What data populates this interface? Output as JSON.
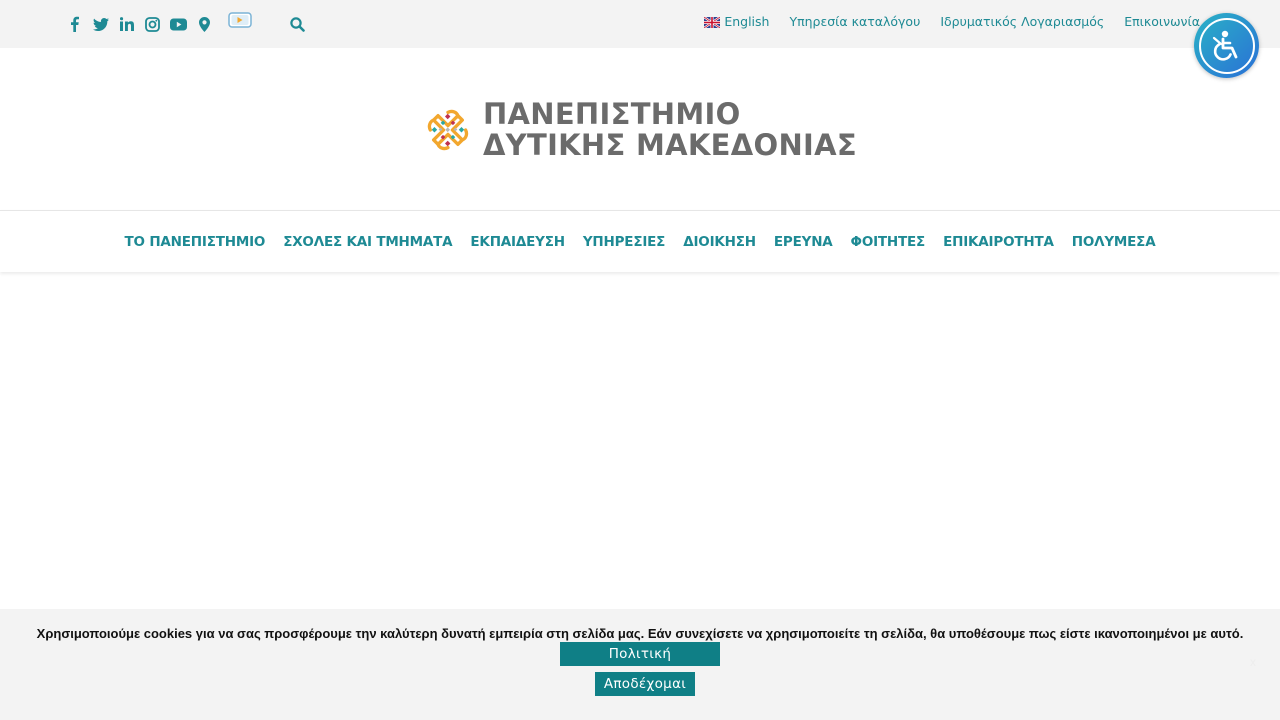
{
  "topbar": {
    "social_icons": [
      "facebook-icon",
      "twitter-icon",
      "linkedin-icon",
      "instagram-icon",
      "youtube-icon",
      "map-marker-icon",
      "video-tv-icon"
    ],
    "search_icon": "search-icon",
    "links": {
      "english": "English",
      "catalog": "Υπηρεσία καταλόγου",
      "account": "Ιδρυματικός Λογαριασμός",
      "contact": "Επικοινωνία"
    }
  },
  "logo": {
    "line1": "ΠΑΝΕΠΙΣΤΗΜΙΟ",
    "line2": "ΔΥΤΙΚΗΣ ΜΑΚΕΔΟΝΙΑΣ"
  },
  "nav": {
    "items": [
      "ΤΟ ΠΑΝΕΠΙΣΤΗΜΙΟ",
      "ΣΧΟΛΕΣ ΚΑΙ ΤΜΗΜΑΤΑ",
      "ΕΚΠΑΙΔΕΥΣΗ",
      "ΥΠΗΡΕΣΙΕΣ",
      "ΔΙΟΙΚΗΣΗ",
      "ΕΡΕΥΝΑ",
      "ΦΟΙΤΗΤΕΣ",
      "ΕΠΙΚΑΙΡΟΤΗΤΑ",
      "ΠΟΛΥΜΕΣΑ"
    ]
  },
  "cookie": {
    "message": "Χρησιμοποιούμε cookies για να σας προσφέρουμε την καλύτερη δυνατή εμπειρία στη σελίδα μας. Εάν συνεχίσετε να χρησιμοποιείτε τη σελίδα, θα υποθέσουμε πως είστε ικανοποιημένοι με αυτό.",
    "policy_label": "Πολιτική απορρήτου",
    "accept_label": "Αποδέχομαι",
    "close_label": "x"
  },
  "colors": {
    "teal": "#1e8a94",
    "button": "#0f7f86",
    "logo_gray": "#6b6b6b",
    "logo_orange": "#f2a72e",
    "logo_red": "#c0334f",
    "logo_teal": "#2aa7a1"
  }
}
